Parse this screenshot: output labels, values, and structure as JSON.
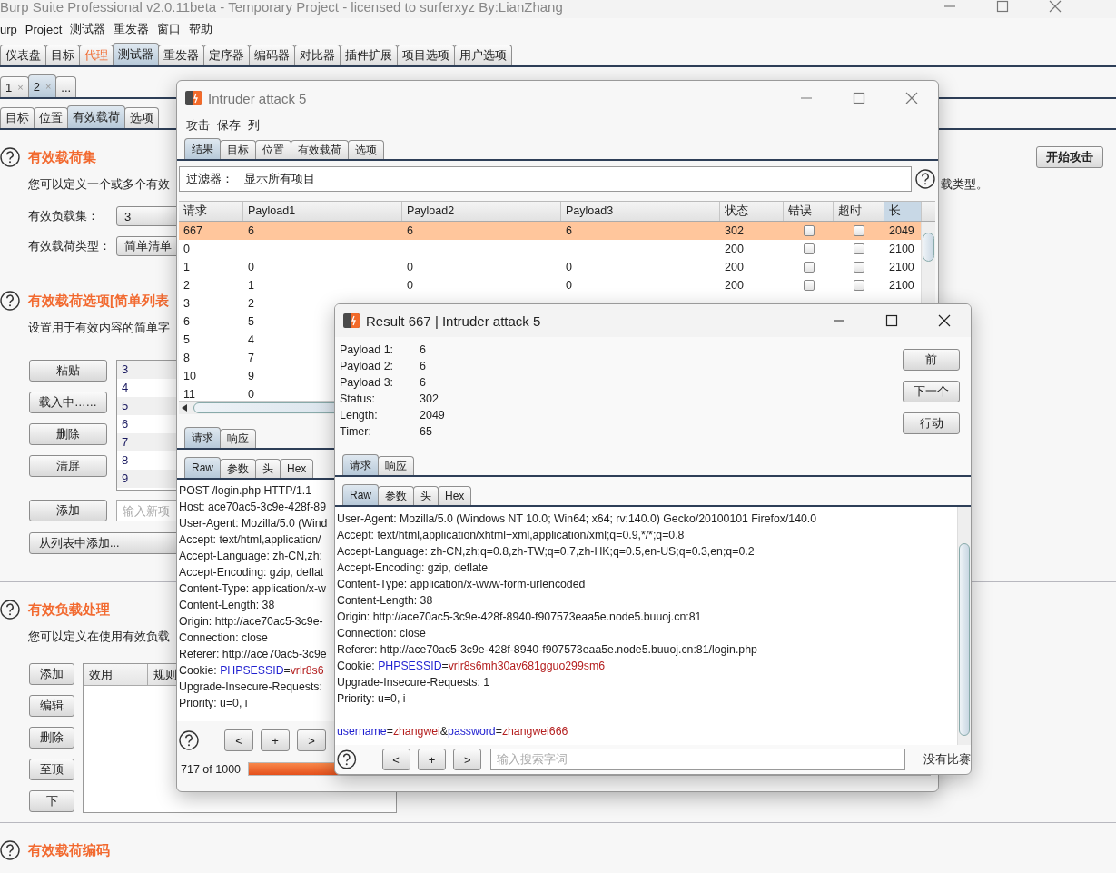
{
  "main_window": {
    "title": "Burp Suite Professional v2.0.11beta - Temporary Project - licensed to surferxyz By:LianZhang",
    "menu": [
      "urp",
      "Project",
      "测试器",
      "重发器",
      "窗口",
      "帮助"
    ],
    "tabs": [
      {
        "label": "仪表盘",
        "selected": false,
        "highlighted": false
      },
      {
        "label": "目标",
        "selected": false,
        "highlighted": false
      },
      {
        "label": "代理",
        "selected": false,
        "highlighted": true
      },
      {
        "label": "测试器",
        "selected": true,
        "highlighted": false
      },
      {
        "label": "重发器",
        "selected": false,
        "highlighted": false
      },
      {
        "label": "定序器",
        "selected": false,
        "highlighted": false
      },
      {
        "label": "编码器",
        "selected": false,
        "highlighted": false
      },
      {
        "label": "对比器",
        "selected": false,
        "highlighted": false
      },
      {
        "label": "插件扩展",
        "selected": false,
        "highlighted": false
      },
      {
        "label": "项目选项",
        "selected": false,
        "highlighted": false
      },
      {
        "label": "用户选项",
        "selected": false,
        "highlighted": false
      }
    ],
    "attack_tabs": [
      {
        "label": "1",
        "close": "×",
        "selected": false
      },
      {
        "label": "2",
        "close": "×",
        "selected": true
      },
      {
        "label": "...",
        "selected": false
      }
    ],
    "config_tabs": [
      {
        "label": "目标",
        "selected": false
      },
      {
        "label": "位置",
        "selected": false
      },
      {
        "label": "有效载荷",
        "selected": true
      },
      {
        "label": "选项",
        "selected": false
      }
    ],
    "start_button": "开始攻击",
    "payload_sets": {
      "title": "有效载荷集",
      "description": "您可以定义一个或多个有效",
      "description_tail": "载类型。",
      "set_label": "有效负载集：",
      "set_value": "3",
      "type_label": "有效载荷类型：",
      "type_value": "简单清单"
    },
    "payload_options": {
      "title": "有效载荷选项[简单列表",
      "description": "设置用于有效内容的简单字",
      "buttons": [
        "粘贴",
        "载入中……",
        "删除",
        "清屏"
      ],
      "items": [
        "3",
        "4",
        "5",
        "6",
        "7",
        "8",
        "9"
      ],
      "add_button": "添加",
      "add_placeholder": "输入新项",
      "add_from_list": "从列表中添加..."
    },
    "payload_processing": {
      "title": "有效负载处理",
      "description": "您可以定义在使用有效负载",
      "buttons": [
        "添加",
        "编辑",
        "删除",
        "至顶",
        "下"
      ],
      "columns": [
        "效用",
        "规则"
      ]
    },
    "payload_encoding": {
      "title": "有效载荷编码"
    }
  },
  "intruder_window": {
    "title": "Intruder attack 5",
    "menu": [
      "攻击",
      "保存",
      "列"
    ],
    "tabs": [
      {
        "label": "结果",
        "selected": true
      },
      {
        "label": "目标",
        "selected": false
      },
      {
        "label": "位置",
        "selected": false
      },
      {
        "label": "有效载荷",
        "selected": false
      },
      {
        "label": "选项",
        "selected": false
      }
    ],
    "filter_label": "过滤器：",
    "filter_value": "显示所有项目",
    "table": {
      "columns": [
        "请求",
        "Payload1",
        "Payload2",
        "Payload3",
        "状态",
        "错误",
        "超时",
        "长"
      ],
      "rows": [
        {
          "cells": [
            "667",
            "6",
            "6",
            "6",
            "302"
          ],
          "error": false,
          "timeout": false,
          "length": "2049",
          "selected": true
        },
        {
          "cells": [
            "0",
            null,
            null,
            null,
            "200"
          ],
          "error": false,
          "timeout": false,
          "length": "2100",
          "selected": false
        },
        {
          "cells": [
            "1",
            "0",
            "0",
            "0",
            "200"
          ],
          "error": false,
          "timeout": false,
          "length": "2100",
          "selected": false
        },
        {
          "cells": [
            "2",
            "1",
            "0",
            "0",
            "200"
          ],
          "error": false,
          "timeout": false,
          "length": "2100",
          "selected": false
        },
        {
          "cells": [
            "3",
            "2"
          ],
          "selected": false
        },
        {
          "cells": [
            "6",
            "5"
          ],
          "selected": false
        },
        {
          "cells": [
            "5",
            "4"
          ],
          "selected": false
        },
        {
          "cells": [
            "8",
            "7"
          ],
          "selected": false
        },
        {
          "cells": [
            "10",
            "9"
          ],
          "selected": false
        },
        {
          "cells": [
            "11",
            "0"
          ],
          "selected": false
        }
      ]
    },
    "editor_tabs": [
      {
        "label": "请求",
        "selected": true
      },
      {
        "label": "响应",
        "selected": false
      }
    ],
    "view_tabs": [
      {
        "label": "Raw",
        "selected": true
      },
      {
        "label": "参数",
        "selected": false
      },
      {
        "label": "头",
        "selected": false
      },
      {
        "label": "Hex",
        "selected": false
      }
    ],
    "request_lines": [
      [
        {
          "kind": "plain",
          "text": "POST /login.php HTTP/1.1"
        }
      ],
      [
        {
          "kind": "plain",
          "text": "Host: ace70ac5-3c9e-428f-89"
        }
      ],
      [
        {
          "kind": "plain",
          "text": "User-Agent: Mozilla/5.0 (Wind"
        }
      ],
      [
        {
          "kind": "plain",
          "text": "Accept: text/html,application/"
        }
      ],
      [
        {
          "kind": "plain",
          "text": "Accept-Language: zh-CN,zh;"
        }
      ],
      [
        {
          "kind": "plain",
          "text": "Accept-Encoding: gzip, deflat"
        }
      ],
      [
        {
          "kind": "plain",
          "text": "Content-Type: application/x-w"
        }
      ],
      [
        {
          "kind": "plain",
          "text": "Content-Length: 38"
        }
      ],
      [
        {
          "kind": "plain",
          "text": "Origin: http://ace70ac5-3c9e-"
        }
      ],
      [
        {
          "kind": "plain",
          "text": "Connection: close"
        }
      ],
      [
        {
          "kind": "plain",
          "text": "Referer: http://ace70ac5-3c9e"
        }
      ],
      [
        {
          "kind": "plain",
          "text": "Cookie: "
        },
        {
          "kind": "name",
          "text": "PHPSESSID"
        },
        {
          "kind": "plain",
          "text": "="
        },
        {
          "kind": "value",
          "text": "vrlr8s6"
        }
      ],
      [
        {
          "kind": "plain",
          "text": "Upgrade-Insecure-Requests: "
        }
      ],
      [
        {
          "kind": "plain",
          "text": "Priority: u=0, i"
        }
      ]
    ],
    "nav_buttons": [
      "<",
      "+",
      ">"
    ],
    "progress_text": "717 of 1000",
    "progress": {
      "level": 0.717
    }
  },
  "result_window": {
    "title": "Result 667 | Intruder attack 5",
    "details": [
      {
        "label": "Payload 1:",
        "value": "6"
      },
      {
        "label": "Payload 2:",
        "value": "6"
      },
      {
        "label": "Payload 3:",
        "value": "6"
      },
      {
        "label": "Status:",
        "value": "302"
      },
      {
        "label": "Length:",
        "value": "2049"
      },
      {
        "label": "Timer:",
        "value": "65"
      }
    ],
    "buttons": [
      "前",
      "下一个",
      "行动"
    ],
    "editor_tabs": [
      {
        "label": "请求",
        "selected": true
      },
      {
        "label": "响应",
        "selected": false
      }
    ],
    "view_tabs": [
      {
        "label": "Raw",
        "selected": true
      },
      {
        "label": "参数",
        "selected": false
      },
      {
        "label": "头",
        "selected": false
      },
      {
        "label": "Hex",
        "selected": false
      }
    ],
    "request_lines": [
      [
        {
          "kind": "plain",
          "text": "User-Agent: Mozilla/5.0 (Windows NT 10.0; Win64; x64; rv:140.0) Gecko/20100101 Firefox/140.0"
        }
      ],
      [
        {
          "kind": "plain",
          "text": "Accept: text/html,application/xhtml+xml,application/xml;q=0.9,*/*;q=0.8"
        }
      ],
      [
        {
          "kind": "plain",
          "text": "Accept-Language: zh-CN,zh;q=0.8,zh-TW;q=0.7,zh-HK;q=0.5,en-US;q=0.3,en;q=0.2"
        }
      ],
      [
        {
          "kind": "plain",
          "text": "Accept-Encoding: gzip, deflate"
        }
      ],
      [
        {
          "kind": "plain",
          "text": "Content-Type: application/x-www-form-urlencoded"
        }
      ],
      [
        {
          "kind": "plain",
          "text": "Content-Length: 38"
        }
      ],
      [
        {
          "kind": "plain",
          "text": "Origin: http://ace70ac5-3c9e-428f-8940-f907573eaa5e.node5.buuoj.cn:81"
        }
      ],
      [
        {
          "kind": "plain",
          "text": "Connection: close"
        }
      ],
      [
        {
          "kind": "plain",
          "text": "Referer: http://ace70ac5-3c9e-428f-8940-f907573eaa5e.node5.buuoj.cn:81/login.php"
        }
      ],
      [
        {
          "kind": "plain",
          "text": "Cookie: "
        },
        {
          "kind": "name",
          "text": "PHPSESSID"
        },
        {
          "kind": "plain",
          "text": "="
        },
        {
          "kind": "value",
          "text": "vrlr8s6mh30av681gguo299sm6"
        }
      ],
      [
        {
          "kind": "plain",
          "text": "Upgrade-Insecure-Requests: 1"
        }
      ],
      [
        {
          "kind": "plain",
          "text": "Priority: u=0, i"
        }
      ],
      [
        {
          "kind": "name",
          "text": "username"
        },
        {
          "kind": "plain",
          "text": "="
        },
        {
          "kind": "value",
          "text": "zhangwei"
        },
        {
          "kind": "plain",
          "text": "&"
        },
        {
          "kind": "name",
          "text": "password"
        },
        {
          "kind": "plain",
          "text": "="
        },
        {
          "kind": "value",
          "text": "zhangwei666"
        }
      ]
    ],
    "nav_buttons": [
      "<",
      "+",
      ">"
    ],
    "search_placeholder": "输入搜索字词",
    "match_status": "没有比赛"
  }
}
